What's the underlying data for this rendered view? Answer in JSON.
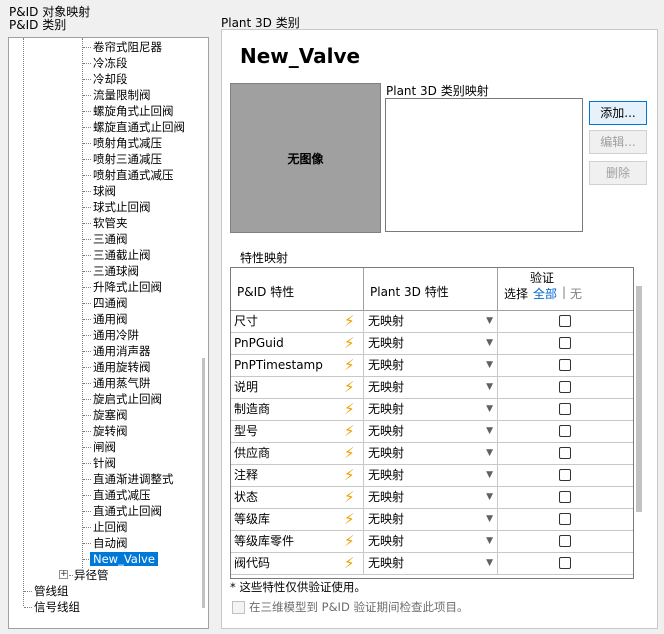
{
  "header": {
    "pid_object_mapping": "P&ID 对象映射",
    "pid_class": "P&ID 类别",
    "plant3d_class": "Plant 3D 类别"
  },
  "tree": {
    "items": [
      "卷帘式阻尼器",
      "冷冻段",
      "冷却段",
      "流量限制阀",
      "螺旋角式止回阀",
      "螺旋直通式止回阀",
      "喷射角式减压",
      "喷射三通减压",
      "喷射直通式减压",
      "球阀",
      "球式止回阀",
      "软管夹",
      "三通阀",
      "三通截止阀",
      "三通球阀",
      "升降式止回阀",
      "四通阀",
      "通用阀",
      "通用冷阱",
      "通用消声器",
      "通用旋转阀",
      "通用蒸气阱",
      "旋启式止回阀",
      "旋塞阀",
      "旋转阀",
      "闸阀",
      "针阀",
      "直通渐进调整式",
      "直通式减压",
      "直通式止回阀",
      "止回阀",
      "自动阀"
    ],
    "selected": "New_Valve",
    "pipes": "异径管",
    "pipeline_group": "管线组",
    "signal_line": "信号线组",
    "expander_symbol": "+"
  },
  "class_detail": {
    "title": "New_Valve",
    "no_image": "无图像",
    "mapping_label": "Plant 3D 类别映射",
    "add_button": "添加...",
    "edit_button": "编辑...",
    "delete_button": "删除"
  },
  "properties": {
    "section_label": "特性映射",
    "col_pid": "P&ID 特性",
    "col_plant": "Plant 3D 特性",
    "col_verify": "验证",
    "select_label": "选择",
    "select_all": "全部",
    "separator": "|",
    "select_none": "无",
    "rows": [
      {
        "pid": "尺寸",
        "plant": "无映射"
      },
      {
        "pid": "PnPGuid",
        "plant": "无映射"
      },
      {
        "pid": "PnPTimestamp",
        "plant": "无映射"
      },
      {
        "pid": "说明",
        "plant": "无映射"
      },
      {
        "pid": "制造商",
        "plant": "无映射"
      },
      {
        "pid": "型号",
        "plant": "无映射"
      },
      {
        "pid": "供应商",
        "plant": "无映射"
      },
      {
        "pid": "注释",
        "plant": "无映射"
      },
      {
        "pid": "状态",
        "plant": "无映射"
      },
      {
        "pid": "等级库",
        "plant": "无映射"
      },
      {
        "pid": "等级库零件",
        "plant": "无映射"
      },
      {
        "pid": "阀代码",
        "plant": "无映射"
      }
    ],
    "footnote": "* 这些特性仅供验证使用。",
    "bottom_check_label": "在三维模型到 P&ID 验证期间检查此项目。"
  },
  "colors": {
    "selection": "#0078d7",
    "bolt": "#f0a000",
    "link": "#0066cc"
  }
}
